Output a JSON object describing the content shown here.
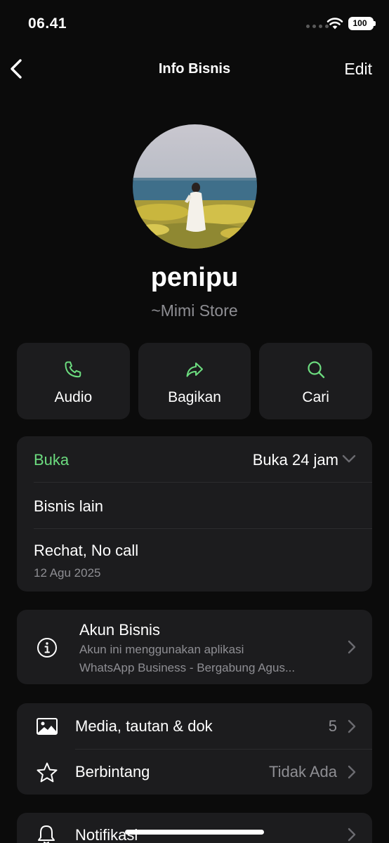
{
  "status_bar": {
    "time": "06.41",
    "battery": "100"
  },
  "nav": {
    "title": "Info Bisnis",
    "edit_label": "Edit"
  },
  "profile": {
    "name": "penipu",
    "subtitle": "~Mimi Store"
  },
  "actions": [
    {
      "label": "Audio",
      "icon": "phone-icon"
    },
    {
      "label": "Bagikan",
      "icon": "share-icon"
    },
    {
      "label": "Cari",
      "icon": "search-icon"
    }
  ],
  "hours": {
    "label": "Buka",
    "value": "Buka 24 jam"
  },
  "other_business": "Bisnis lain",
  "about": {
    "text": "Rechat, No call",
    "date": "12 Agu 2025"
  },
  "account": {
    "title": "Akun Bisnis",
    "desc_line1": "Akun ini menggunakan aplikasi",
    "desc_line2": "WhatsApp Business - Bergabung Agus..."
  },
  "media": {
    "label": "Media, tautan & dok",
    "count": "5"
  },
  "starred": {
    "label": "Berbintang",
    "value": "Tidak Ada"
  },
  "notifications": {
    "label": "Notifikasi"
  },
  "colors": {
    "accent_green": "#6cdc7f",
    "card_bg": "#1c1c1e",
    "background": "#0b0b0b",
    "secondary_text": "#8e8e93"
  }
}
